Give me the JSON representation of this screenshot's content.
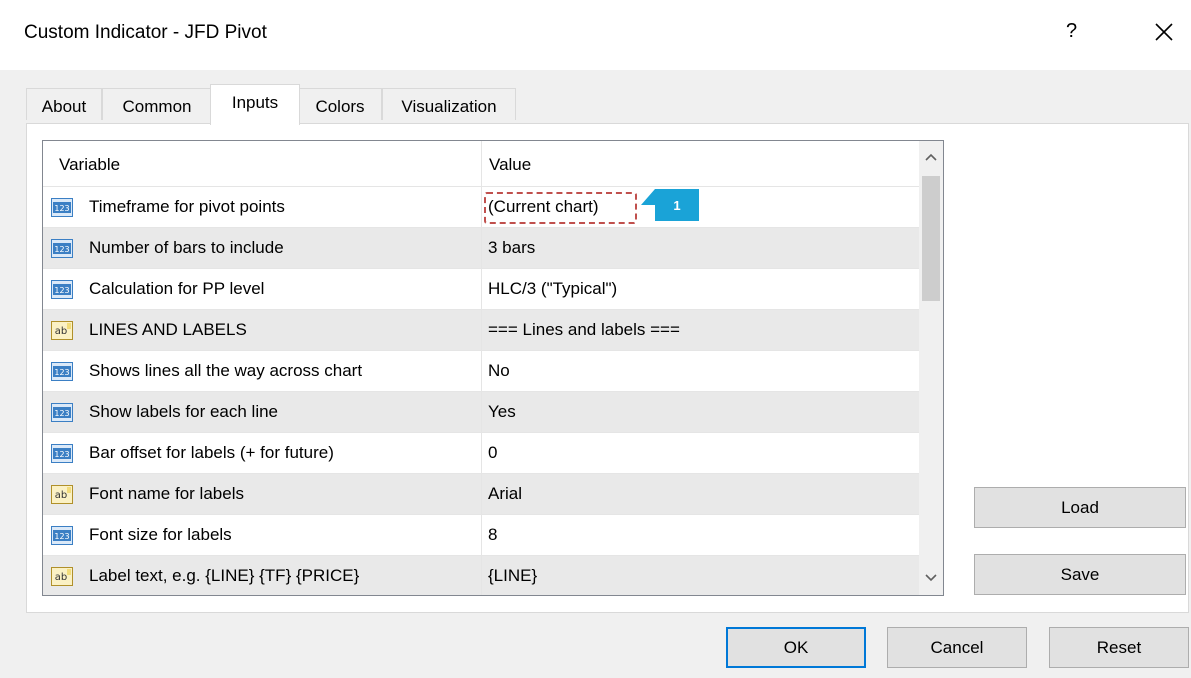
{
  "window": {
    "title": "Custom Indicator - JFD Pivot",
    "help_label": "?"
  },
  "tabs": [
    {
      "label": "About"
    },
    {
      "label": "Common"
    },
    {
      "label": "Inputs"
    },
    {
      "label": "Colors"
    },
    {
      "label": "Visualization"
    }
  ],
  "active_tab": "Inputs",
  "grid": {
    "headers": {
      "variable": "Variable",
      "value": "Value"
    },
    "rows": [
      {
        "type": "int-icon",
        "name": "Timeframe for pivot points",
        "value": "(Current chart)"
      },
      {
        "type": "int-icon",
        "name": "Number of bars to include",
        "value": "3 bars"
      },
      {
        "type": "int-icon",
        "name": "Calculation for PP level",
        "value": "HLC/3 (\"Typical\")"
      },
      {
        "type": "string-icon",
        "name": "LINES AND LABELS",
        "value": "=== Lines and labels ==="
      },
      {
        "type": "int-icon",
        "name": "Shows lines all the way across chart",
        "value": "No"
      },
      {
        "type": "int-icon",
        "name": "Show labels for each line",
        "value": "Yes"
      },
      {
        "type": "int-icon",
        "name": "Bar offset for labels (+ for future)",
        "value": "0"
      },
      {
        "type": "string-icon",
        "name": "Font name for labels",
        "value": "Arial"
      },
      {
        "type": "int-icon",
        "name": "Font size for labels",
        "value": "8"
      },
      {
        "type": "string-icon",
        "name": "Label text, e.g. {LINE} {TF} {PRICE}",
        "value": "{LINE}"
      }
    ]
  },
  "callout": {
    "number": "1",
    "color": "#1aa3d7"
  },
  "buttons": {
    "load": "Load",
    "save": "Save",
    "ok": "OK",
    "cancel": "Cancel",
    "reset": "Reset"
  },
  "colors": {
    "accent": "#0078d7",
    "highlight_border": "#c0504d",
    "int_icon": "#3b7fc4",
    "string_icon": "#e0c34a"
  }
}
